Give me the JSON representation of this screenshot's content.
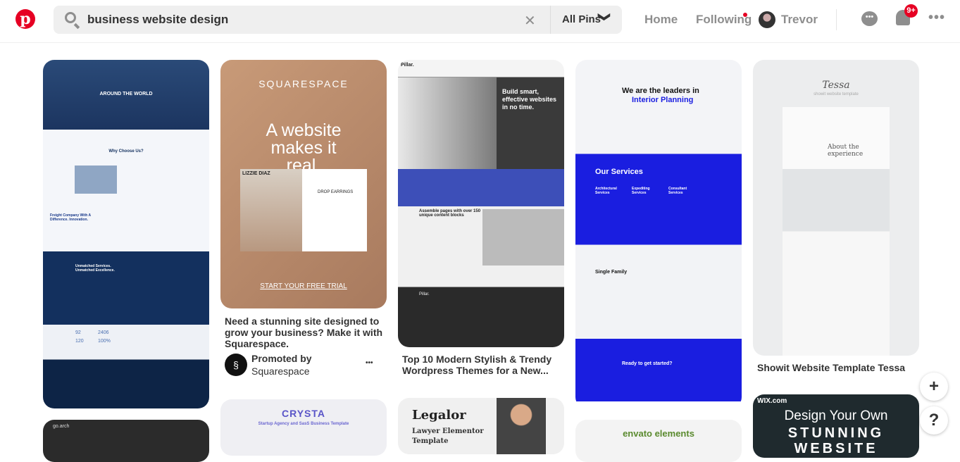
{
  "header": {
    "logo": "p",
    "search": {
      "value": "business website design",
      "clear": "✕",
      "scope": "All Pins",
      "scope_chevron": "❯"
    },
    "nav": {
      "home": "Home",
      "following": "Following",
      "user": "Trevor"
    },
    "notifications_badge": "9+",
    "more": "•••",
    "messages": "•••"
  },
  "colors": {
    "brand": "#e60023",
    "blue": "#1a1ee0",
    "navy": "#0f2a55"
  },
  "pins": [
    {
      "image_text": [
        "AROUND THE WORLD",
        "Why Choose Us?",
        "Freight Company With A Difference. Innovation.",
        "Unmatched Services. Unmatched Excellence.",
        "92",
        "2406",
        "120",
        "100%"
      ]
    },
    {
      "image_text": [
        "SQUARESPACE",
        "A website makes it real.",
        "LIZZIE DIAZ",
        "DROP EARRINGS",
        "START YOUR FREE TRIAL"
      ],
      "caption": "Need a stunning site designed to grow your business? Make it with Squarespace.",
      "promoted_by": "Promoted by",
      "advertiser": "Squarespace",
      "more": "•••"
    },
    {
      "image_text": [
        "Pillar.",
        "Build smart, effective websites in no time.",
        "Assemble pages with over 150 unique content blocks",
        "Pillar."
      ],
      "caption": "Top 10 Modern Stylish & Trendy Wordpress Themes for a New..."
    },
    {
      "image_text": [
        "We are the leaders in",
        "Interior Planning",
        "Our Services",
        "Architectural Services",
        "Expediting Services",
        "Consultant Services",
        "Single Family",
        "Ready to get started?"
      ]
    },
    {
      "image_text": [
        "Tessa",
        "showit website template",
        "About the experience"
      ],
      "caption": "Showit Website Template Tessa"
    }
  ],
  "more_pins": [
    {
      "image_text": [
        "go.arch"
      ]
    },
    {
      "image_text": [
        "CRYSTA",
        "Startup Agency and SasS Business Template"
      ]
    },
    {
      "image_text": [
        "Legalor",
        "Lawyer Elementor",
        "Template"
      ]
    },
    {
      "image_text": [
        "envato elements"
      ]
    },
    {
      "image_text": [
        "WIX.com",
        "Design Your Own",
        "STUNNING",
        "WEBSITE"
      ]
    }
  ],
  "fabs": {
    "add": "+",
    "help": "?"
  }
}
